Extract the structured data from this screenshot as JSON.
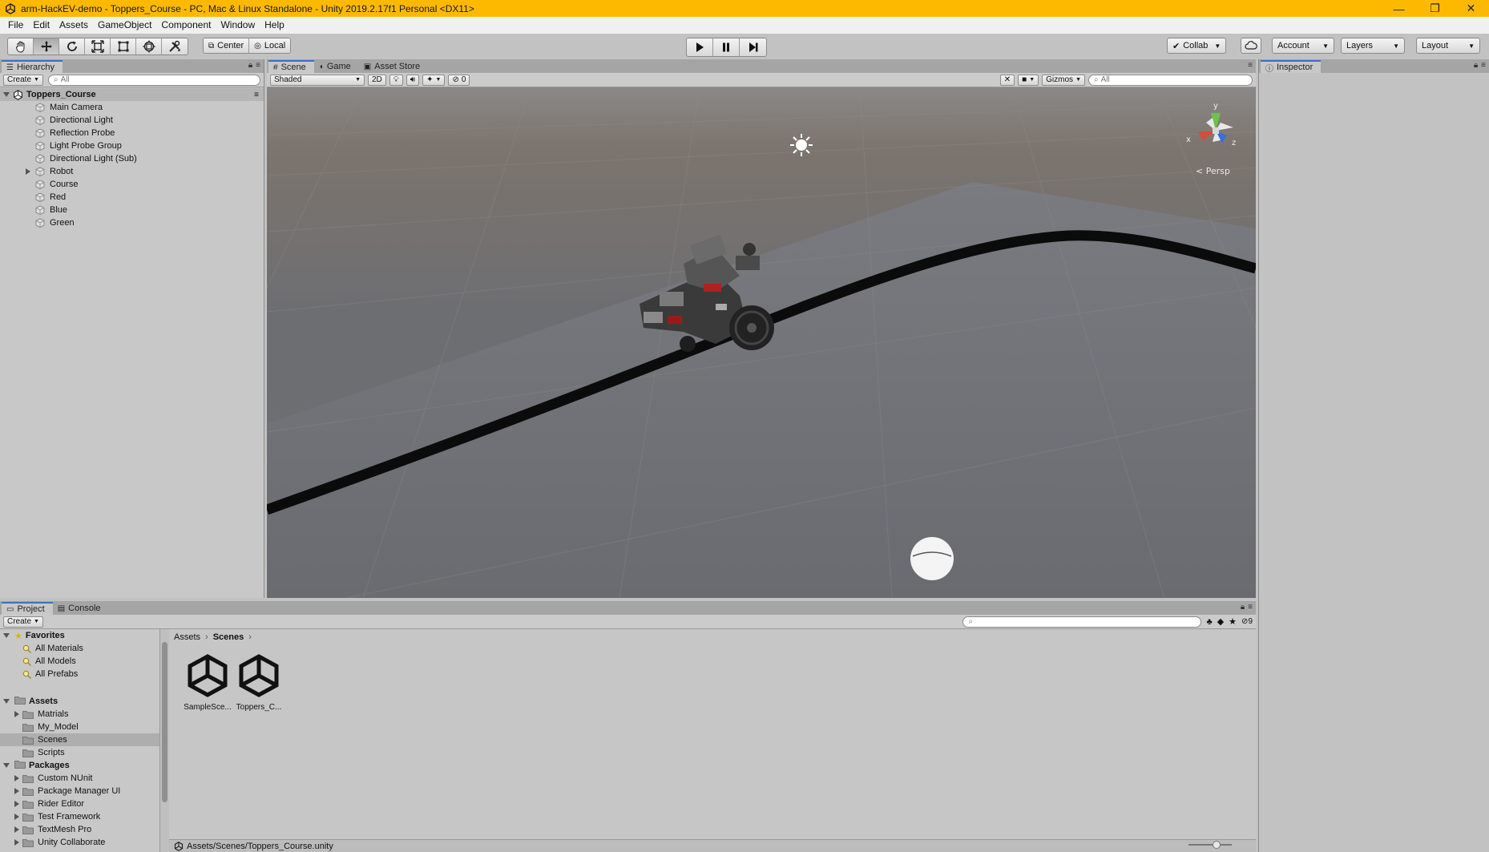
{
  "window": {
    "title": "arm-HackEV-demo - Toppers_Course - PC, Mac & Linux Standalone - Unity 2019.2.17f1 Personal <DX11>",
    "minimize": "—",
    "restore": "❐",
    "close": "✕"
  },
  "menu": [
    "File",
    "Edit",
    "Assets",
    "GameObject",
    "Component",
    "Window",
    "Help"
  ],
  "toolbar": {
    "tools": [
      {
        "name": "hand-tool",
        "icon": "hand-icon"
      },
      {
        "name": "move-tool",
        "icon": "move-icon"
      },
      {
        "name": "rotate-tool",
        "icon": "rotate-icon"
      },
      {
        "name": "scale-tool",
        "icon": "scale-icon"
      },
      {
        "name": "rect-tool",
        "icon": "rect-icon"
      },
      {
        "name": "transform-tool",
        "icon": "transform-icon"
      },
      {
        "name": "custom-tool",
        "icon": "tools-icon"
      }
    ],
    "pivot_label": "Center",
    "space_label": "Local",
    "collab_label": "Collab",
    "account_label": "Account",
    "layers_label": "Layers",
    "layout_label": "Layout"
  },
  "hierarchy": {
    "tab_label": "Hierarchy",
    "create_label": "Create",
    "search_placeholder": "All",
    "scene_name": "Toppers_Course",
    "items": [
      {
        "label": "Main Camera",
        "has_children": false
      },
      {
        "label": "Directional Light",
        "has_children": false
      },
      {
        "label": "Reflection Probe",
        "has_children": false
      },
      {
        "label": "Light Probe Group",
        "has_children": false
      },
      {
        "label": "Directional Light (Sub)",
        "has_children": false
      },
      {
        "label": "Robot",
        "has_children": true
      },
      {
        "label": "Course",
        "has_children": false
      },
      {
        "label": "Red",
        "has_children": false
      },
      {
        "label": "Blue",
        "has_children": false
      },
      {
        "label": "Green",
        "has_children": false
      }
    ]
  },
  "scene": {
    "tabs": [
      "Scene",
      "Game",
      "Asset Store"
    ],
    "active_tab": "Scene",
    "draw_mode": "Shaded",
    "mode_2d_label": "2D",
    "hidden_count": "0",
    "gizmos_label": "Gizmos",
    "search_placeholder": "All",
    "projection_label": "Persp",
    "axis_y": "y",
    "axis_x": "x",
    "axis_z": "z"
  },
  "inspector": {
    "tab_label": "Inspector"
  },
  "project": {
    "tabs": [
      "Project",
      "Console"
    ],
    "active_tab": "Project",
    "create_label": "Create",
    "hidden_count": "9",
    "favorites_label": "Favorites",
    "favorites": [
      "All Materials",
      "All Models",
      "All Prefabs"
    ],
    "assets_label": "Assets",
    "assets": [
      {
        "label": "Matrials",
        "has_children": true,
        "selected": false
      },
      {
        "label": "My_Model",
        "has_children": false,
        "selected": false
      },
      {
        "label": "Scenes",
        "has_children": false,
        "selected": true
      },
      {
        "label": "Scripts",
        "has_children": false,
        "selected": false
      }
    ],
    "packages_label": "Packages",
    "packages": [
      "Custom NUnit",
      "Package Manager UI",
      "Rider Editor",
      "Test Framework",
      "TextMesh Pro",
      "Unity Collaborate"
    ],
    "breadcrumb": [
      "Assets",
      "Scenes"
    ],
    "files": [
      "SampleSce...",
      "Toppers_C..."
    ],
    "status_path": "Assets/Scenes/Toppers_Course.unity"
  }
}
